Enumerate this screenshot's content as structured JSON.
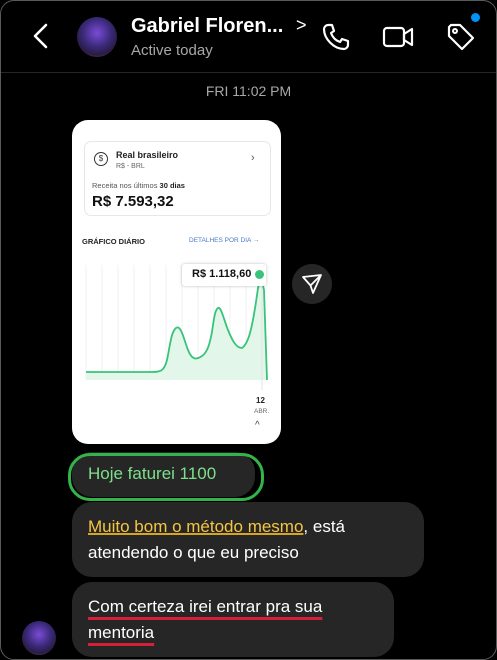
{
  "header": {
    "name": "Gabriel Floren...",
    "status": "Active today",
    "name_chevron": ">"
  },
  "timestamp": "FRI 11:02 PM",
  "shared_card": {
    "account_title": "Real brasileiro",
    "account_subtitle": "R$ - BRL",
    "coin_symbol": "$",
    "account_chevron": "›",
    "period_prefix": "Receita nos últimos ",
    "period_days": "30 dias",
    "revenue": "R$ 7.593,32",
    "chart_title": "GRÁFICO DIÁRIO",
    "chart_link": "DETALHES POR DIA →",
    "tooltip_value": "R$ 1.118,60",
    "tick_day": "12",
    "tick_month": "ABR.",
    "caret": "^",
    "accent_color": "#37c37a"
  },
  "messages": [
    {
      "text": "Hoje faturei 1100",
      "highlight_color": "#33b44a"
    },
    {
      "highlighted": "Muito bom o método mesmo",
      "rest": ", está atendendo o que eu preciso"
    },
    {
      "underlined_1": "Com certeza irei entrar pra sua",
      "underlined_2": "mentoria"
    }
  ],
  "icons": {
    "back": "back-arrow-icon",
    "call": "phone-icon",
    "video": "video-camera-icon",
    "tag": "tag-icon",
    "share": "send-icon"
  },
  "colors": {
    "background": "#000000",
    "bubble": "#262626",
    "notification_dot": "#0095f6",
    "highlight_yellow": "#f5c542",
    "underline_red": "#d6203a"
  }
}
